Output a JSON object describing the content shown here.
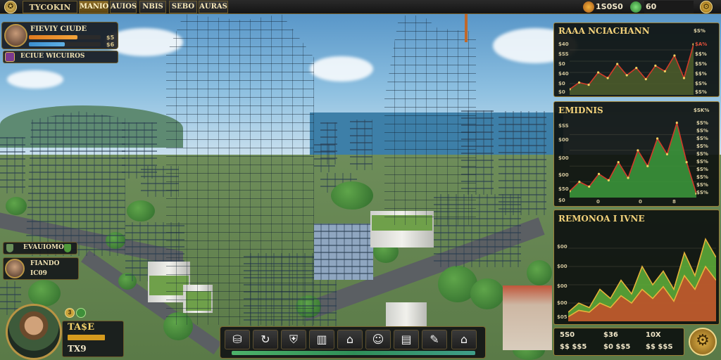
{
  "topbar": {
    "game_title": "TYCOKIN",
    "logo_glyph": "✪",
    "tabs": [
      {
        "label": "MANIO",
        "active": true
      },
      {
        "label": "AUIOS",
        "active": false
      },
      {
        "label": "NBIS",
        "active": false
      },
      {
        "label": "SEBO",
        "active": false
      },
      {
        "label": "AURAS",
        "active": false
      }
    ],
    "coins": "1S0S0",
    "cash": "60",
    "coin_icon": "coin-icon",
    "cash_icon": "cash-icon",
    "menu_icon": "gear-icon"
  },
  "player": {
    "name": "FIEVIY CIUDE",
    "bar1_value": "$5",
    "bar1_level": 0.68,
    "bar2_value": "$6",
    "bar2_level": 0.5,
    "sub_label": "ECIUE WICUIROS"
  },
  "left_widgets": {
    "item1": "EVAUIOMOS",
    "item2_top": "FIANDO",
    "item2_bottom": "IC09"
  },
  "character": {
    "level_badge": "3",
    "money": "TA$E",
    "money_level": 0.85,
    "count": "TX9"
  },
  "toolbar": {
    "tools": [
      {
        "name": "build-tool",
        "icon": "⛁"
      },
      {
        "name": "rotate-tool",
        "icon": "↻"
      },
      {
        "name": "shield-tool",
        "icon": "⛨"
      },
      {
        "name": "factory-tool",
        "icon": "▥"
      },
      {
        "name": "shop-tool",
        "icon": "⌂"
      },
      {
        "name": "people-tool",
        "icon": "☺"
      },
      {
        "name": "cards-tool",
        "icon": "▤"
      },
      {
        "name": "pencil-tool",
        "icon": "✎"
      },
      {
        "name": "home-tool",
        "icon": "⌂"
      }
    ],
    "progress_level": 1.0
  },
  "panels": {
    "p1": {
      "title": "RAAA NCIACHANN",
      "header_value": "$S%",
      "ticks": [
        "$40",
        "$SS",
        "$0",
        "$40",
        "$0",
        "$0"
      ],
      "right_values": [
        "$A%",
        "$$%",
        "$S%",
        "$$%",
        "$S%",
        "$S%"
      ]
    },
    "p2": {
      "title": "EMIDNIS",
      "header_value": "$SK%",
      "ticks": [
        "$SS",
        "$00",
        "$00",
        "$00",
        "$50",
        "$0"
      ],
      "right_values": [
        "$S%",
        "$S%",
        "$S%",
        "$S%",
        "$S%",
        "$S%",
        "$S%",
        "$S%",
        "$S%",
        "$S%"
      ],
      "x_ticks": [
        "0",
        "0",
        "8"
      ]
    },
    "p3": {
      "title": "REMONOA I IVNE",
      "ticks": [
        "$00",
        "$00",
        "$00",
        "$00",
        "$05"
      ]
    }
  },
  "bottom_stats": {
    "r1": [
      "5S0",
      "$36",
      "10X"
    ],
    "r2": [
      "$$ $$5",
      "$0 $$5",
      "$$ $$S"
    ]
  },
  "chart_data": [
    {
      "type": "line",
      "title": "RAAA NCIACHANN",
      "series": [
        {
          "values": [
            10,
            22,
            18,
            40,
            30,
            55,
            35,
            48,
            28,
            52,
            42,
            70,
            30,
            90
          ]
        }
      ],
      "ylim": [
        0,
        100
      ],
      "colors": {
        "line": "#d23a2a",
        "area": "#4e5e2c"
      }
    },
    {
      "type": "area",
      "title": "EMIDNIS",
      "series": [
        {
          "values": [
            8,
            20,
            14,
            30,
            22,
            45,
            25,
            60,
            40,
            75,
            55,
            95,
            45,
            5
          ]
        }
      ],
      "ylim": [
        0,
        100
      ],
      "colors": {
        "line": "#d23a2a",
        "area": "#3c9a3c"
      }
    },
    {
      "type": "area",
      "title": "REMONOA I IVNE",
      "series": [
        {
          "values": [
            10,
            20,
            15,
            35,
            25,
            45,
            30,
            60,
            40,
            55,
            35,
            75,
            50,
            90,
            70
          ]
        },
        {
          "values": [
            5,
            12,
            10,
            20,
            15,
            28,
            20,
            35,
            25,
            38,
            22,
            50,
            35,
            60,
            45
          ]
        }
      ],
      "ylim": [
        0,
        100
      ],
      "colors": {
        "area_top": "#5fb13a",
        "area_bottom": "#c0502a",
        "line": "#e6b23a"
      }
    }
  ]
}
